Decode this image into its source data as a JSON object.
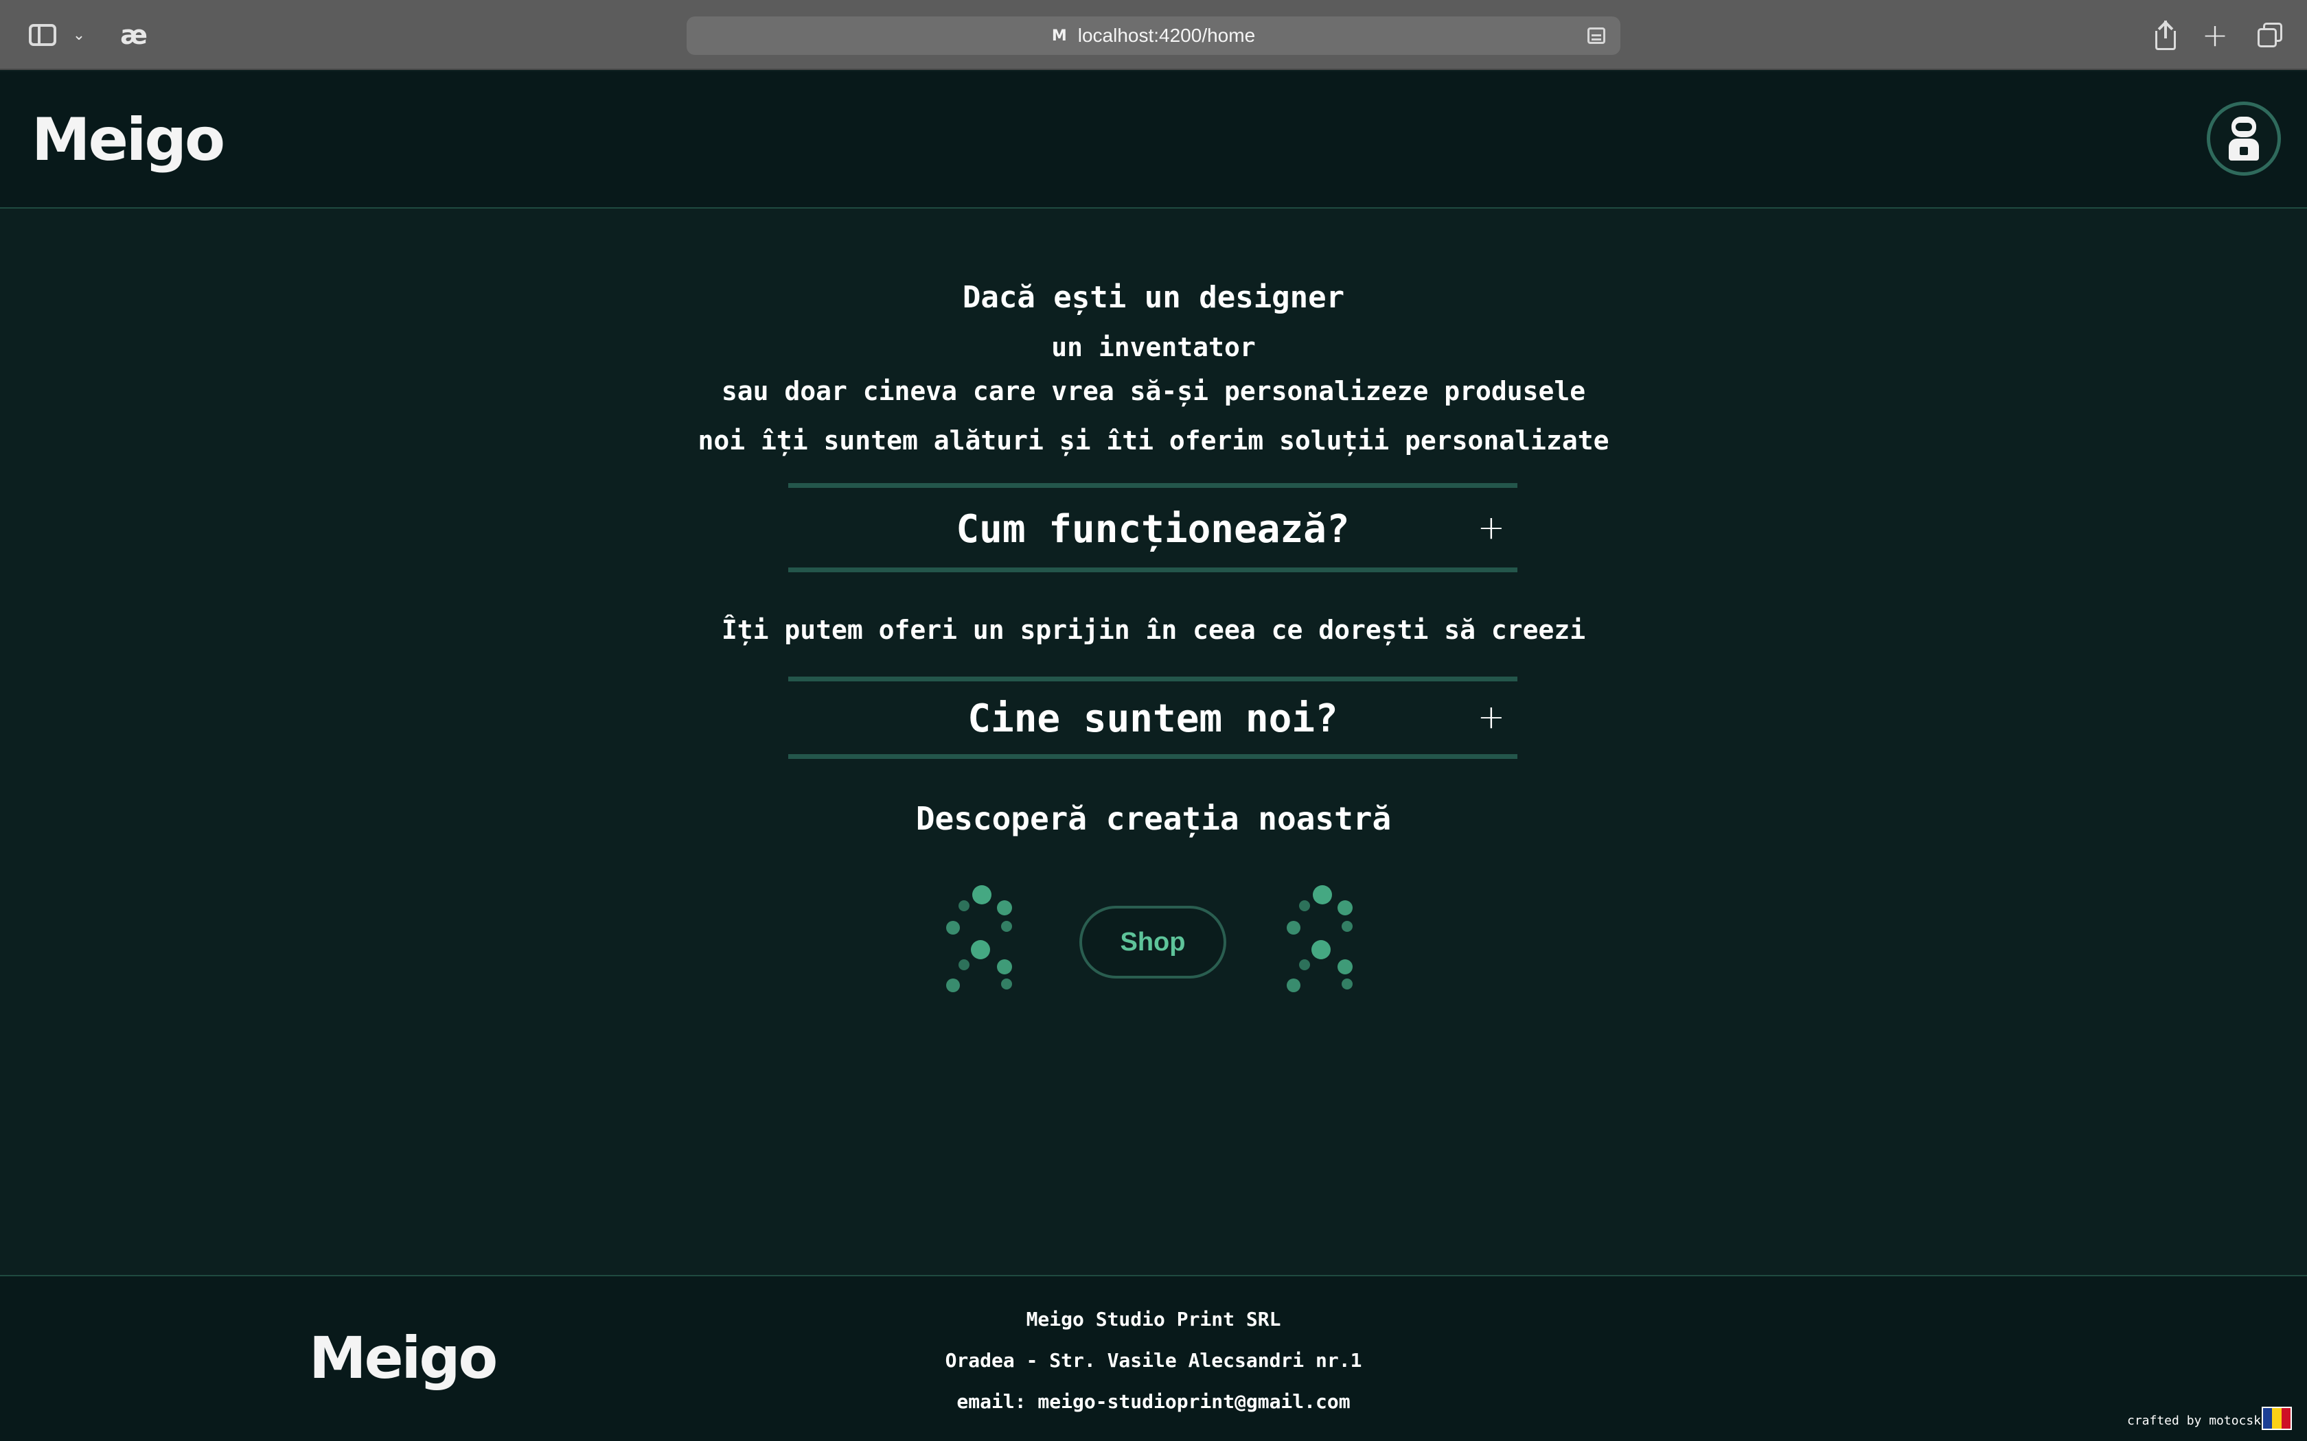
{
  "browser": {
    "url": "localhost:4200/home",
    "favicon_letter": "M",
    "extension_glyph": "æ",
    "chevron_glyph": "⌄",
    "plus_glyph": "+"
  },
  "header": {
    "logo": "Meigo",
    "avatar": "robot-avatar"
  },
  "intro": {
    "line1": "Dacă ești un designer",
    "line2": "un inventator",
    "line3": "sau doar cineva care vrea să-și personalizeze produsele",
    "line4": "noi îți suntem alături și îti oferim soluții personalizate"
  },
  "accordions": [
    {
      "title": "Cum funcționează?",
      "toggle": "+"
    },
    {
      "title": "Cine suntem noi?",
      "toggle": "+"
    }
  ],
  "support_text": "Îți putem oferi un sprijin în ceea ce dorești să creezi",
  "discover_text": "Descoperă creația noastră",
  "shop_button": "Shop",
  "footer": {
    "logo": "Meigo",
    "company": "Meigo Studio Print SRL",
    "address": "Oradea - Str. Vasile Alecsandri nr.1",
    "email": "email: meigo-studioprint@gmail.com",
    "crafted": "crafted by motocsky",
    "flag_colors": [
      "#1c3f95",
      "#fcd116",
      "#ce1126"
    ]
  },
  "colors": {
    "background": "#0c1f1f",
    "header_background": "#08191a",
    "accent": "#45a882",
    "divider": "#24564b"
  }
}
